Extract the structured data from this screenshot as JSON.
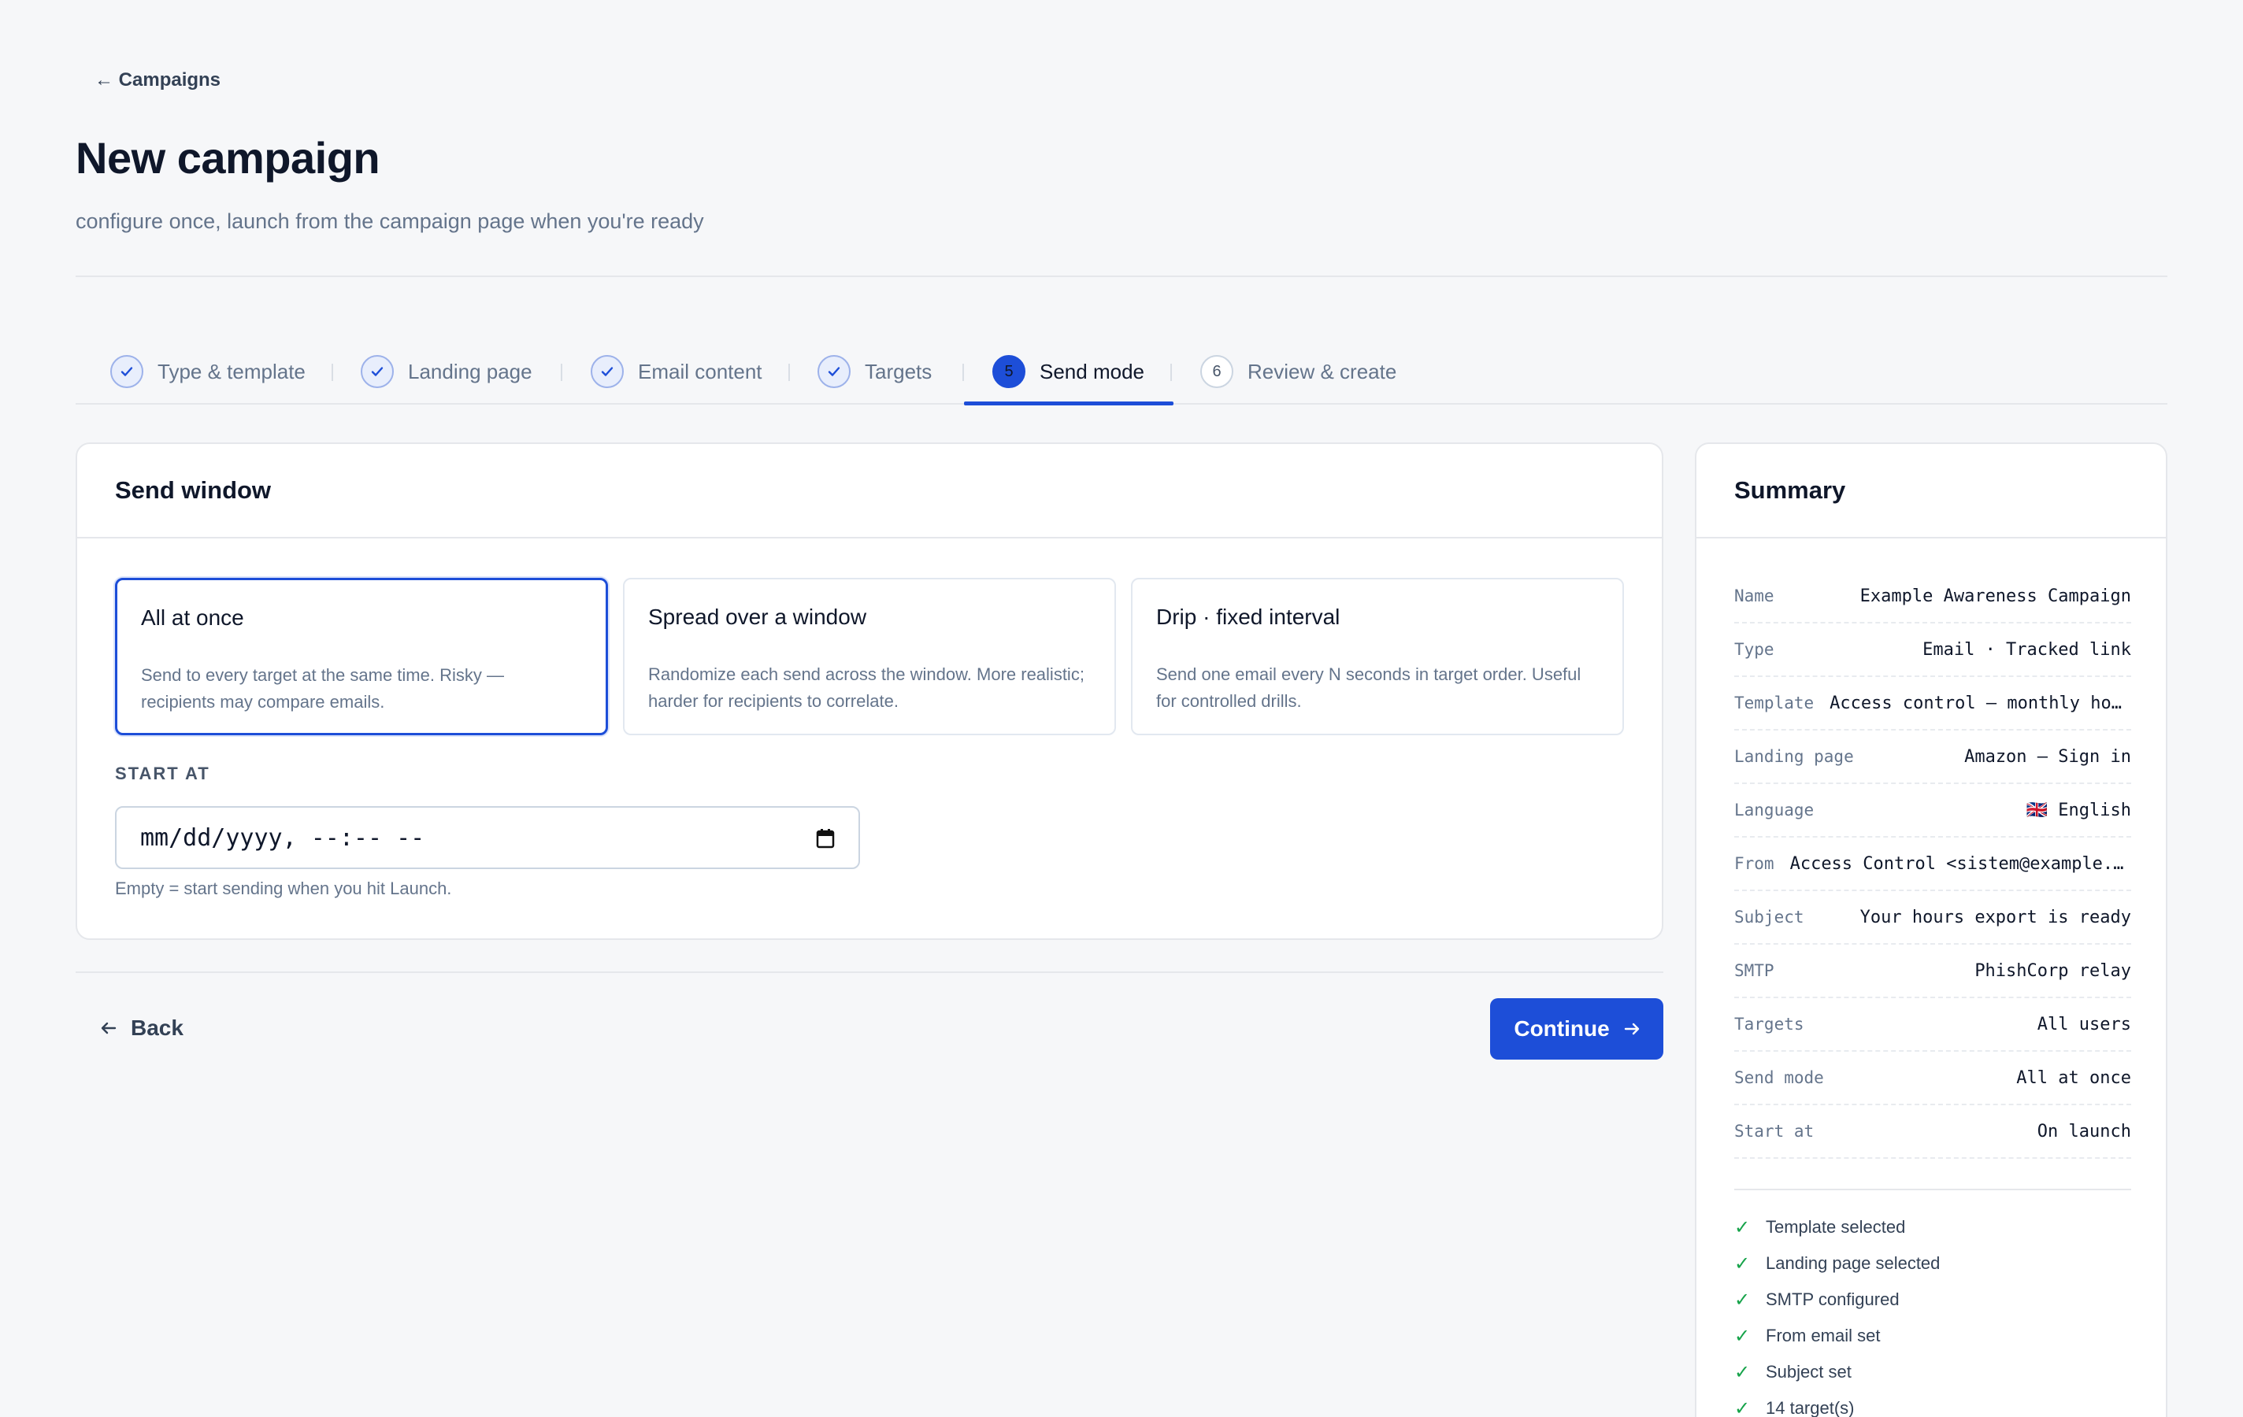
{
  "nav": {
    "back_label": "← Campaigns"
  },
  "header": {
    "title": "New campaign",
    "subtitle": "configure once, launch from the campaign page when you're ready"
  },
  "stepper": {
    "steps": [
      {
        "label": "Type & template",
        "marker": "✓",
        "state": "done"
      },
      {
        "label": "Landing page",
        "marker": "✓",
        "state": "done"
      },
      {
        "label": "Email content",
        "marker": "✓",
        "state": "done"
      },
      {
        "label": "Targets",
        "marker": "✓",
        "state": "done"
      },
      {
        "label": "Send mode",
        "marker": "5",
        "state": "active"
      },
      {
        "label": "Review & create",
        "marker": "6",
        "state": "pending"
      }
    ]
  },
  "send_window": {
    "title": "Send window",
    "options": [
      {
        "title": "All at once",
        "description": "Send to every target at the same time. Risky — recipients may compare emails.",
        "selected": true
      },
      {
        "title": "Spread over a window",
        "description": "Randomize each send across the window. More realistic; harder for recipients to correlate.",
        "selected": false
      },
      {
        "title": "Drip · fixed interval",
        "description": "Send one email every N seconds in target order. Useful for controlled drills.",
        "selected": false
      }
    ],
    "start_at_label": "START AT",
    "start_at_placeholder": "mm/dd/yyyy, --:-- --",
    "start_at_hint": "Empty = start sending when you hit Launch."
  },
  "footer": {
    "back_label": "Back",
    "continue_label": "Continue"
  },
  "summary": {
    "title": "Summary",
    "rows": [
      {
        "key": "Name",
        "value": "Example Awareness Campaign"
      },
      {
        "key": "Type",
        "value": "Email · Tracked link"
      },
      {
        "key": "Template",
        "value": "Access control — monthly hours export"
      },
      {
        "key": "Landing page",
        "value": "Amazon — Sign in"
      },
      {
        "key": "Language",
        "value": "🇬🇧 English"
      },
      {
        "key": "From",
        "value": "Access Control <sistem@example.com>"
      },
      {
        "key": "Subject",
        "value": "Your hours export is ready"
      },
      {
        "key": "SMTP",
        "value": "PhishCorp relay"
      },
      {
        "key": "Targets",
        "value": "All users"
      },
      {
        "key": "Send mode",
        "value": "All at once"
      },
      {
        "key": "Start at",
        "value": "On launch"
      }
    ],
    "checks": [
      "Template selected",
      "Landing page selected",
      "SMTP configured",
      "From email set",
      "Subject set",
      "14 target(s)"
    ]
  },
  "colors": {
    "accent": "#1d4ed8",
    "success": "#16a34a",
    "background": "#f6f7f9"
  }
}
